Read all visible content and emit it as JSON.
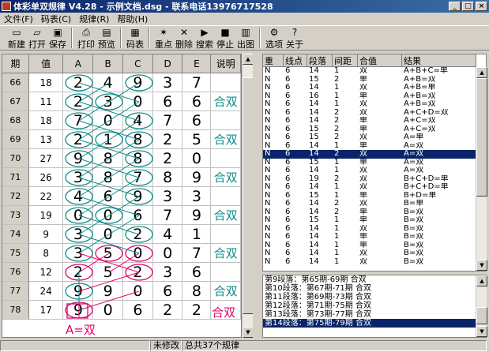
{
  "window": {
    "title": "体彩单双规律 V4.28 - 示例文档.dsg - 联系电话13976717528"
  },
  "menu": [
    "文件(F)",
    "码表(C)",
    "规律(R)",
    "帮助(H)"
  ],
  "toolbar": [
    {
      "label": "新建",
      "icon": "new-doc-icon",
      "glyph": "▭"
    },
    {
      "label": "打开",
      "icon": "open-folder-icon",
      "glyph": "▱"
    },
    {
      "label": "保存",
      "icon": "save-disk-icon",
      "glyph": "▣"
    },
    {
      "label": "打印",
      "icon": "printer-icon",
      "glyph": "⎙"
    },
    {
      "label": "预览",
      "icon": "preview-icon",
      "glyph": "▤"
    },
    {
      "label": "码表",
      "icon": "code-table-icon",
      "glyph": "▦"
    },
    {
      "label": "重点",
      "icon": "star-icon",
      "glyph": "✶"
    },
    {
      "label": "删除",
      "icon": "delete-x-icon",
      "glyph": "✕"
    },
    {
      "label": "搜索",
      "icon": "search-play-icon",
      "glyph": "▶"
    },
    {
      "label": "停止",
      "icon": "stop-icon",
      "glyph": "■"
    },
    {
      "label": "出图",
      "icon": "chart-image-icon",
      "glyph": "▥"
    },
    {
      "label": "选项",
      "icon": "options-icon",
      "glyph": "⚙"
    },
    {
      "label": "关于",
      "icon": "about-icon",
      "glyph": "?"
    }
  ],
  "grid": {
    "headers": [
      "期",
      "值",
      "A",
      "B",
      "C",
      "D",
      "E",
      "说明"
    ],
    "rows": [
      {
        "period": "66",
        "value": "18",
        "a": "2",
        "b": "4",
        "c": "9",
        "d": "3",
        "e": "7",
        "note": ""
      },
      {
        "period": "67",
        "value": "11",
        "a": "2",
        "b": "3",
        "c": "0",
        "d": "6",
        "e": "6",
        "note": "合双"
      },
      {
        "period": "68",
        "value": "18",
        "a": "7",
        "b": "0",
        "c": "4",
        "d": "7",
        "e": "6",
        "note": ""
      },
      {
        "period": "69",
        "value": "13",
        "a": "2",
        "b": "1",
        "c": "8",
        "d": "2",
        "e": "5",
        "note": "合双"
      },
      {
        "period": "70",
        "value": "27",
        "a": "9",
        "b": "8",
        "c": "8",
        "d": "2",
        "e": "0",
        "note": ""
      },
      {
        "period": "71",
        "value": "26",
        "a": "3",
        "b": "8",
        "c": "7",
        "d": "8",
        "e": "9",
        "note": "合双"
      },
      {
        "period": "72",
        "value": "22",
        "a": "4",
        "b": "6",
        "c": "9",
        "d": "3",
        "e": "3",
        "note": ""
      },
      {
        "period": "73",
        "value": "19",
        "a": "0",
        "b": "0",
        "c": "6",
        "d": "7",
        "e": "9",
        "note": "合双"
      },
      {
        "period": "74",
        "value": "9",
        "a": "3",
        "b": "0",
        "c": "2",
        "d": "4",
        "e": "1",
        "note": ""
      },
      {
        "period": "75",
        "value": "8",
        "a": "3",
        "b": "5",
        "c": "0",
        "d": "0",
        "e": "7",
        "note": "合双"
      },
      {
        "period": "76",
        "value": "12",
        "a": "2",
        "b": "5",
        "c": "2",
        "d": "3",
        "e": "6",
        "note": ""
      },
      {
        "period": "77",
        "value": "24",
        "a": "9",
        "b": "9",
        "c": "0",
        "d": "6",
        "e": "8",
        "note": "合双"
      },
      {
        "period": "78",
        "value": "17",
        "a": "9",
        "b": "0",
        "c": "6",
        "d": "2",
        "e": "2",
        "note": ""
      }
    ],
    "extra_note": "合双",
    "prediction_label": "A=双"
  },
  "results": {
    "headers": [
      "重",
      "线点",
      "段落",
      "间距",
      "合值",
      "结果"
    ],
    "rows": [
      [
        "N",
        "6",
        "14",
        "1",
        "双",
        "A+B+C=单"
      ],
      [
        "N",
        "6",
        "15",
        "2",
        "单",
        "A+B=双"
      ],
      [
        "N",
        "6",
        "14",
        "1",
        "双",
        "A+B=单"
      ],
      [
        "N",
        "6",
        "16",
        "1",
        "单",
        "A+B=双"
      ],
      [
        "N",
        "6",
        "14",
        "1",
        "双",
        "A+B=双"
      ],
      [
        "N",
        "6",
        "14",
        "2",
        "双",
        "A+C+D=双"
      ],
      [
        "N",
        "6",
        "14",
        "2",
        "单",
        "A+C=双"
      ],
      [
        "N",
        "6",
        "15",
        "2",
        "单",
        "A+C=双"
      ],
      [
        "N",
        "6",
        "15",
        "2",
        "双",
        "A=单"
      ],
      [
        "N",
        "6",
        "14",
        "1",
        "单",
        "A=双"
      ],
      [
        "N",
        "6",
        "14",
        "2",
        "双",
        "A=双"
      ],
      [
        "N",
        "6",
        "15",
        "1",
        "单",
        "A=双"
      ],
      [
        "N",
        "6",
        "14",
        "1",
        "双",
        "A=双"
      ],
      [
        "N",
        "6",
        "19",
        "2",
        "双",
        "B+C+D=单"
      ],
      [
        "N",
        "6",
        "14",
        "1",
        "双",
        "B+C+D=单"
      ],
      [
        "N",
        "6",
        "15",
        "1",
        "单",
        "B+D=单"
      ],
      [
        "N",
        "6",
        "14",
        "2",
        "双",
        "B=单"
      ],
      [
        "N",
        "6",
        "14",
        "2",
        "单",
        "B=双"
      ],
      [
        "N",
        "6",
        "15",
        "1",
        "单",
        "B=双"
      ],
      [
        "N",
        "6",
        "14",
        "1",
        "双",
        "B=双"
      ],
      [
        "N",
        "6",
        "14",
        "1",
        "单",
        "B=双"
      ],
      [
        "N",
        "6",
        "14",
        "1",
        "单",
        "B=双"
      ],
      [
        "N",
        "6",
        "14",
        "1",
        "双",
        "B=双"
      ],
      [
        "N",
        "6",
        "14",
        "1",
        "双",
        "B=双"
      ]
    ],
    "selected_index": 10
  },
  "segments": {
    "items": [
      "第9段落：第65期-69期 合双",
      "第10段落：第67期-71期 合双",
      "第11段落：第69期-73期 合双",
      "第12段落：第71期-75期 合双",
      "第13段落：第73期-77期 合双",
      "第14段落：第75期-79期 合双"
    ],
    "selected_index": 5
  },
  "status": {
    "modified": "未修改",
    "total": "总共37个规律"
  },
  "colors": {
    "teal": "#0c8c88",
    "magenta": "#e0006a",
    "selection": "#0a246a"
  }
}
